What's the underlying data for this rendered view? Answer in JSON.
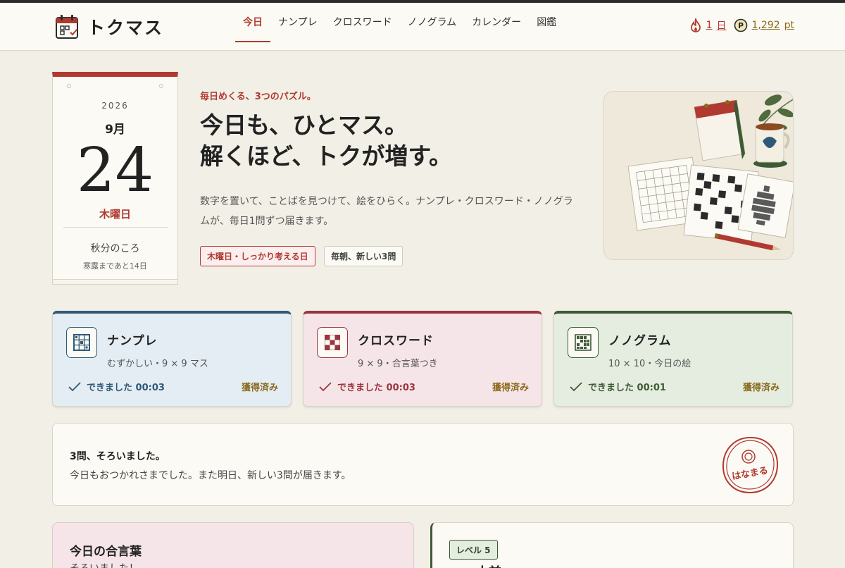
{
  "header": {
    "brand": "トクマス",
    "nav": [
      "今日",
      "ナンプレ",
      "クロスワード",
      "ノノグラム",
      "カレンダー",
      "図鑑"
    ],
    "active_index": 0,
    "streak": {
      "value": "1",
      "unit": "日",
      "icon": "flame-icon"
    },
    "points": {
      "value": "1,292",
      "unit": "pt",
      "icon": "coin-icon"
    }
  },
  "calendar": {
    "year": "2026",
    "month": "9月",
    "day": "24",
    "weekday": "木曜日",
    "season": "秋分のころ",
    "next_season": "寒露まであと14日"
  },
  "hero": {
    "eyebrow": "毎日めくる、3つのパズル。",
    "title_line1": "今日も、ひとマス。",
    "title_line2": "解くほど、トクが増す。",
    "description": "数字を置いて、ことばを見つけて、絵をひらく。ナンプレ・クロスワード・ノノグラムが、毎日1問ずつ届きます。",
    "tag_primary": "木曜日・しっかり考える日",
    "tag_secondary": "毎朝、新しい3問"
  },
  "puzzles": [
    {
      "name": "ナンプレ",
      "detail": "むずかしい・9 × 9 マス",
      "done": "できました 00:03",
      "status": "獲得済み",
      "icon": "sudoku-grid-icon"
    },
    {
      "name": "クロスワード",
      "detail": "9 × 9・合言葉つき",
      "done": "できました 00:03",
      "status": "獲得済み",
      "icon": "crossword-grid-icon"
    },
    {
      "name": "ノノグラム",
      "detail": "10 × 10・今日の絵",
      "done": "できました 00:01",
      "status": "獲得済み",
      "icon": "nonogram-grid-icon"
    }
  ],
  "complete": {
    "title": "3問、そろいました。",
    "message": "今日もおつかれさまでした。また明日、新しい3問が届きます。",
    "stamp": "はなまる"
  },
  "password_card": {
    "title": "今日の合言葉",
    "subtitle": "そろいました！"
  },
  "level_card": {
    "badge": "レベル 5",
    "rank": "一人前"
  },
  "colors": {
    "accent_red": "#b03a30",
    "sudoku_blue": "#2f5978",
    "cross_red": "#9a3640",
    "nono_green": "#3e5a35",
    "gold": "#8a6a1d",
    "background": "#f1efe6"
  }
}
